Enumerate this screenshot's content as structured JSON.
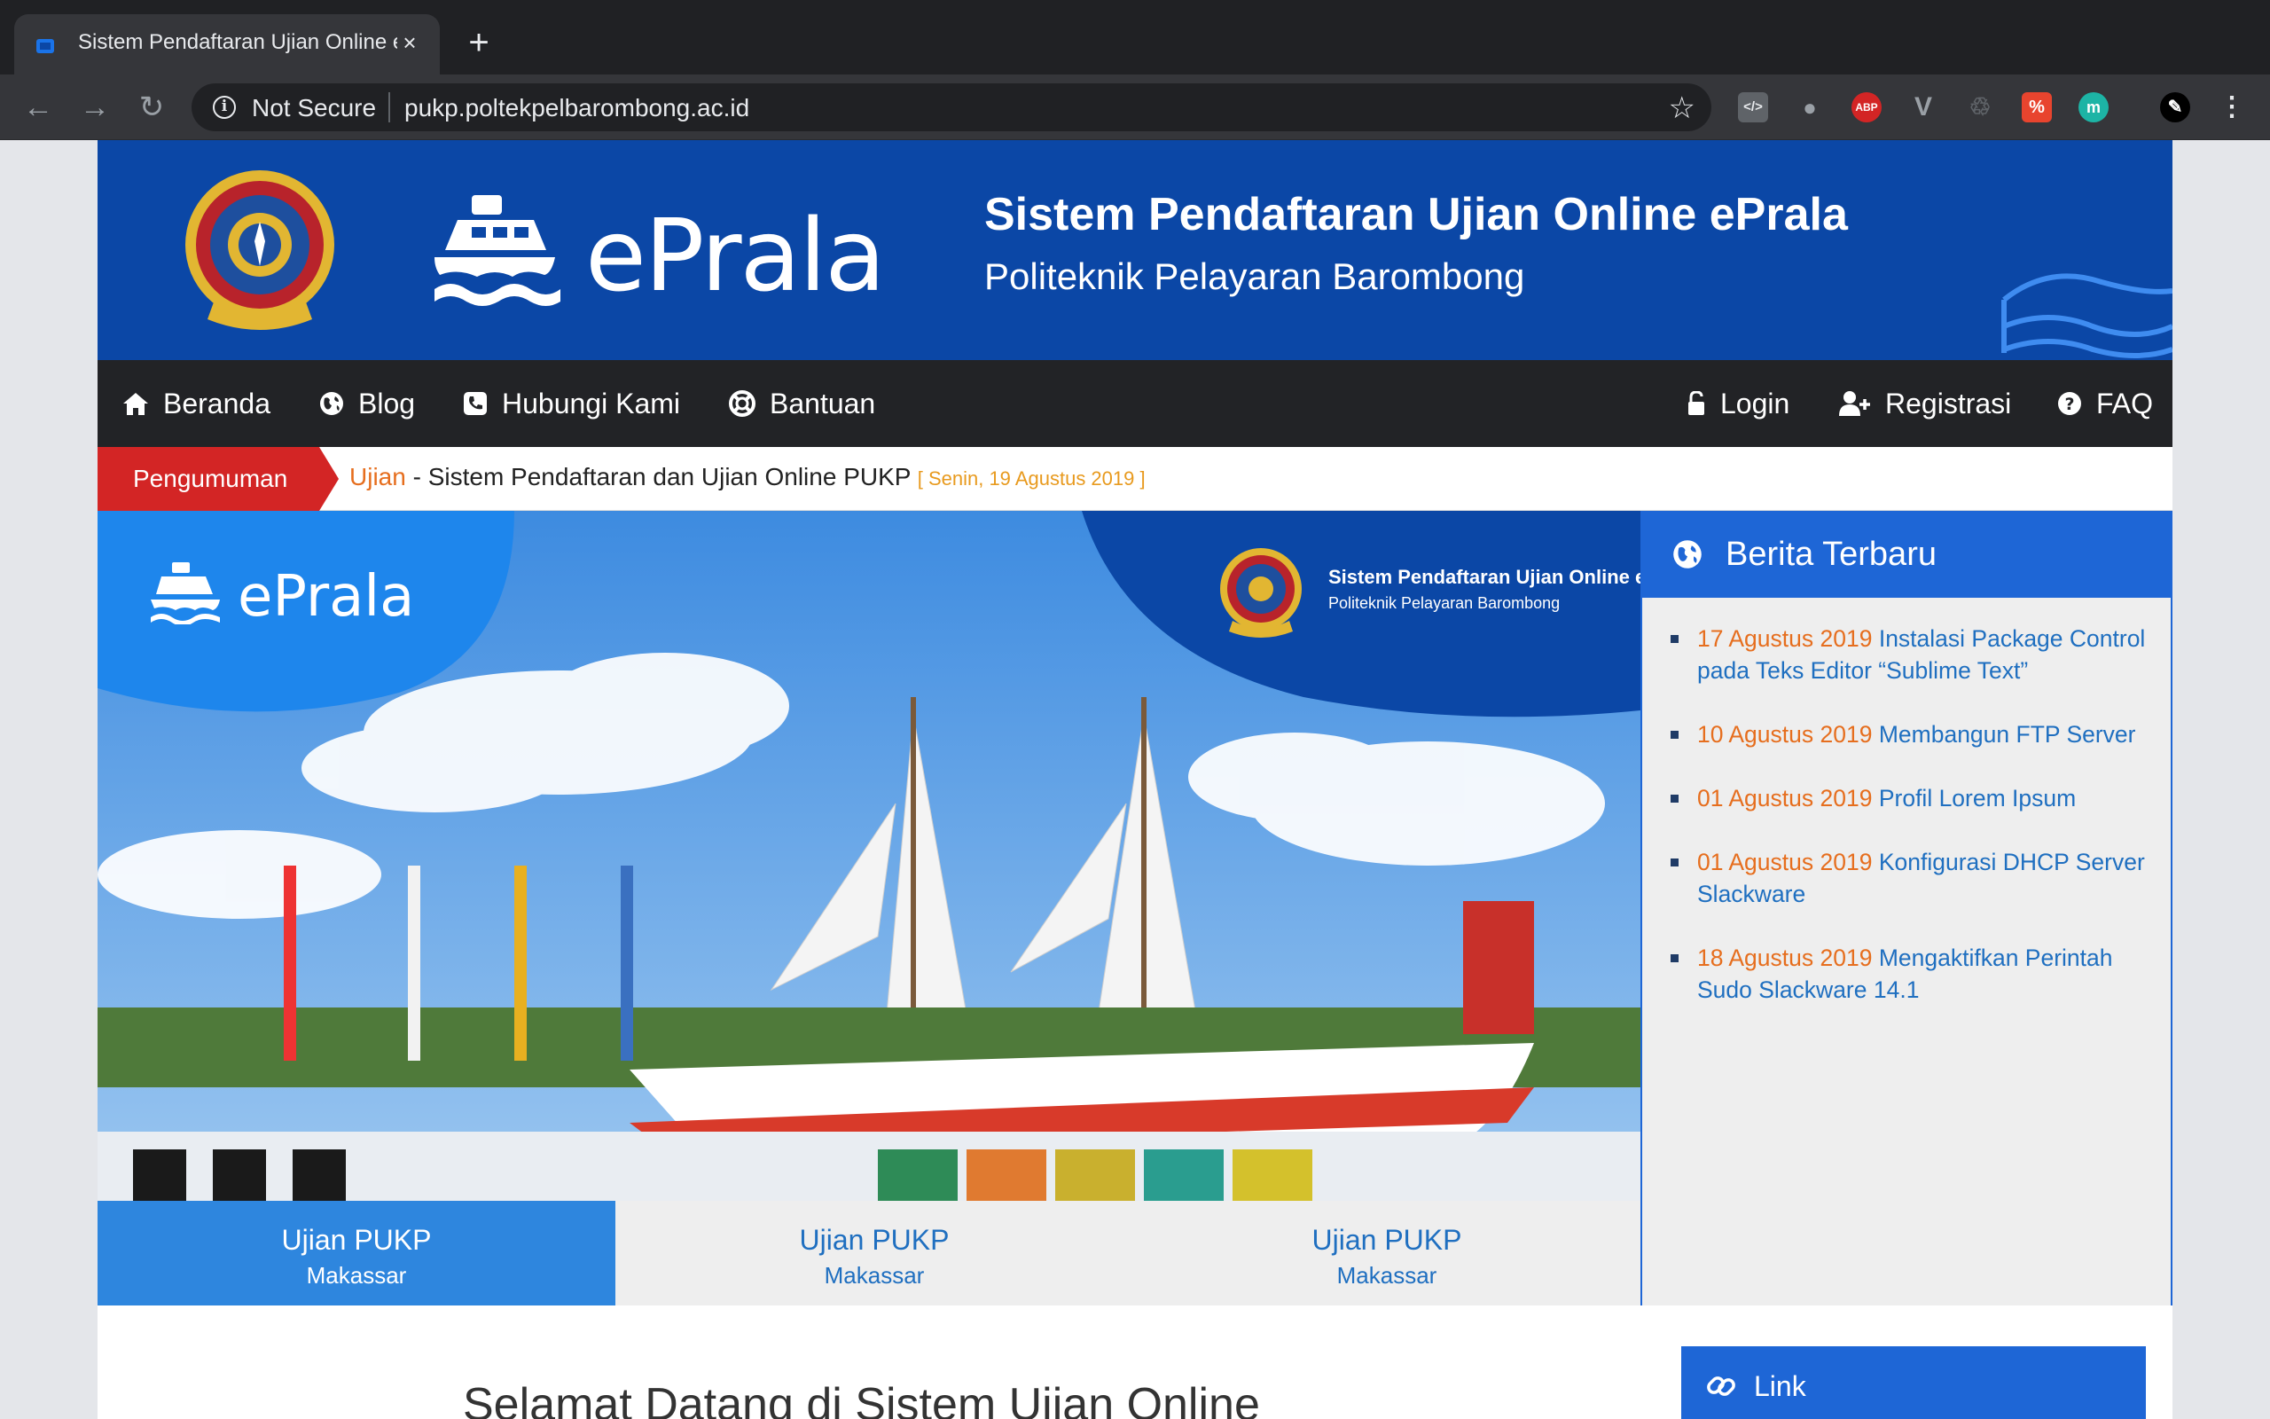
{
  "browser": {
    "tab_title": "Sistem Pendaftaran Ujian Online ePrala",
    "new_tab": "+",
    "close": "×",
    "security_label": "Not Secure",
    "url": "pukp.poltekpelbarombong.ac.id"
  },
  "header": {
    "brand": "ePrala",
    "title": "Sistem Pendaftaran Ujian Online ePrala",
    "subtitle": "Politeknik Pelayaran Barombong",
    "seal_text": "POLITEKNIK PELAYARAN BAROMBONG"
  },
  "nav": {
    "left": [
      {
        "label": "Beranda",
        "icon": "home-icon"
      },
      {
        "label": "Blog",
        "icon": "globe-icon"
      },
      {
        "label": "Hubungi Kami",
        "icon": "phone-icon"
      },
      {
        "label": "Bantuan",
        "icon": "lifebuoy-icon"
      }
    ],
    "right": [
      {
        "label": "Login",
        "icon": "unlock-icon"
      },
      {
        "label": "Registrasi",
        "icon": "user-plus-icon"
      },
      {
        "label": "FAQ",
        "icon": "question-icon"
      }
    ]
  },
  "ticker": {
    "label": "Pengumuman",
    "category": "Ujian",
    "separator": " - ",
    "text": "Sistem Pendaftaran dan Ujian Online PUKP",
    "date": "[ Senin, 19 Agustus 2019 ]"
  },
  "hero": {
    "brand": "ePrala",
    "title": "Sistem Pendaftaran Ujian Online ePrala",
    "subtitle": "Politeknik Pelayaran Barombong"
  },
  "hero_tabs": [
    {
      "title": "Ujian PUKP",
      "sub": "Makassar",
      "active": true
    },
    {
      "title": "Ujian PUKP",
      "sub": "Makassar",
      "active": false
    },
    {
      "title": "Ujian PUKP",
      "sub": "Makassar",
      "active": false
    }
  ],
  "news": {
    "heading": "Berita Terbaru",
    "items": [
      {
        "date": "17 Agustus 2019",
        "title": "Instalasi Package Control pada Teks Editor “Sublime Text”"
      },
      {
        "date": "10 Agustus 2019",
        "title": "Membangun FTP Server"
      },
      {
        "date": "01 Agustus 2019",
        "title": "Profil Lorem Ipsum"
      },
      {
        "date": "01 Agustus 2019",
        "title": "Konfigurasi DHCP Server Slackware"
      },
      {
        "date": "18 Agustus 2019",
        "title": "Mengaktifkan Perintah Sudo Slackware 14.1"
      }
    ]
  },
  "welcome": "Selamat Datang di Sistem Ujian Online",
  "link_box": "Link",
  "colors": {
    "header_blue": "#0b47a6",
    "nav_dark": "#222326",
    "accent_blue": "#1e66d6",
    "tab_active": "#2e86de",
    "orange": "#e66e1e",
    "red": "#d32525"
  }
}
